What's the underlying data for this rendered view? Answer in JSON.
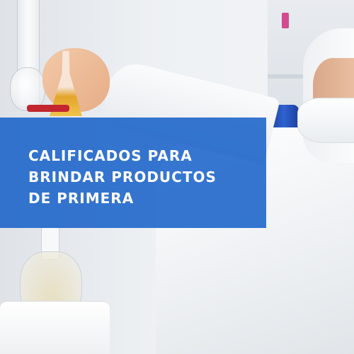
{
  "banner": {
    "lines": [
      "CALIFICADOS PARA",
      "BRINDAR PRODUCTOS",
      "DE PRIMERA"
    ]
  },
  "colors": {
    "banner": "#1560c8",
    "text": "#ffffff",
    "liquid": "#e3a52b"
  }
}
